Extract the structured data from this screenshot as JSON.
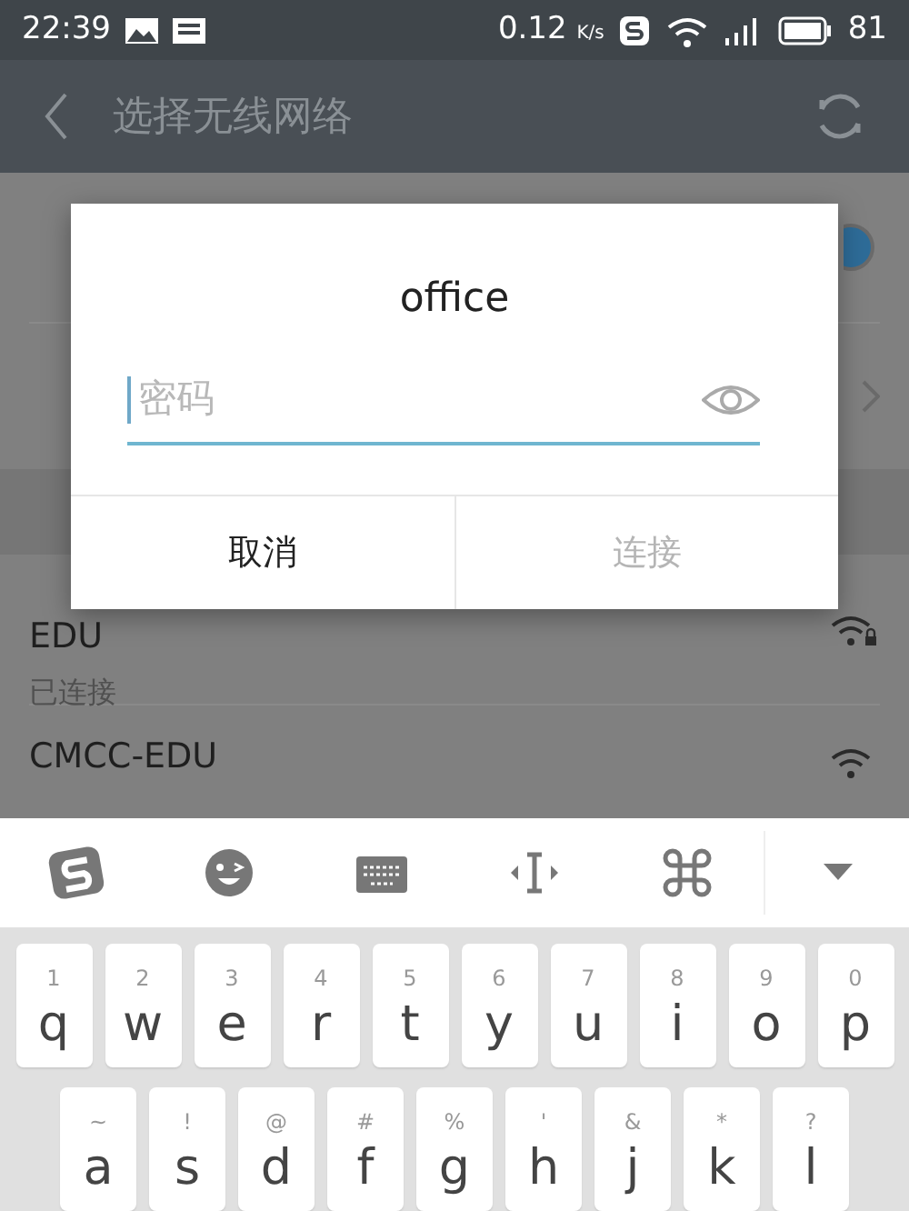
{
  "status_bar": {
    "time": "22:39",
    "speed": "0.12",
    "speed_unit": "K/s",
    "battery": "81"
  },
  "header": {
    "title": "选择无线网络"
  },
  "settings_rows": [
    {
      "kind": "toggle",
      "on": true
    },
    {
      "kind": "chevron"
    }
  ],
  "networks": [
    {
      "name": "EDU",
      "status": "已连接",
      "locked": true
    },
    {
      "name": "CMCC-EDU",
      "locked": false
    }
  ],
  "dialog": {
    "title": "office",
    "password": {
      "placeholder": "密码"
    },
    "buttons": [
      {
        "label": "取消",
        "disabled": false
      },
      {
        "label": "连接",
        "disabled": true
      }
    ]
  },
  "keyboard": {
    "rows": [
      [
        {
          "hint": "1",
          "key": "q"
        },
        {
          "hint": "2",
          "key": "w"
        },
        {
          "hint": "3",
          "key": "e"
        },
        {
          "hint": "4",
          "key": "r"
        },
        {
          "hint": "5",
          "key": "t"
        },
        {
          "hint": "6",
          "key": "y"
        },
        {
          "hint": "7",
          "key": "u"
        },
        {
          "hint": "8",
          "key": "i"
        },
        {
          "hint": "9",
          "key": "o"
        },
        {
          "hint": "0",
          "key": "p"
        }
      ],
      [
        {
          "hint": "~",
          "key": "a"
        },
        {
          "hint": "!",
          "key": "s"
        },
        {
          "hint": "@",
          "key": "d"
        },
        {
          "hint": "#",
          "key": "f"
        },
        {
          "hint": "%",
          "key": "g"
        },
        {
          "hint": "'",
          "key": "h"
        },
        {
          "hint": "&",
          "key": "j"
        },
        {
          "hint": "*",
          "key": "k"
        },
        {
          "hint": "?",
          "key": "l"
        }
      ]
    ]
  }
}
